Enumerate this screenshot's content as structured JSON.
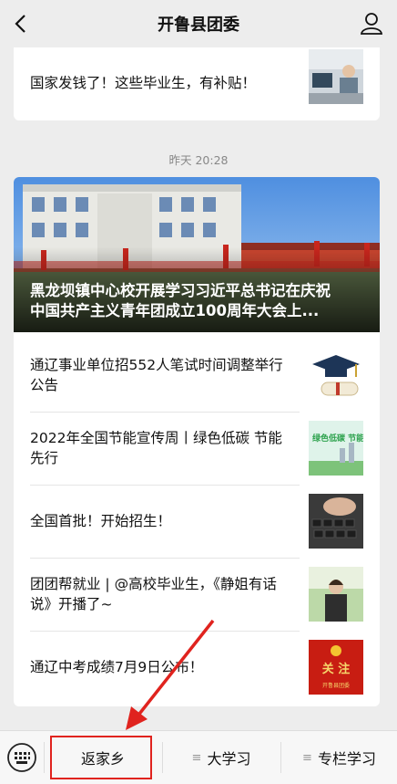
{
  "header": {
    "title": "开鲁县团委"
  },
  "top_article": {
    "title": "国家发钱了！这些毕业生，有补贴！"
  },
  "timestamp": "昨天 20:28",
  "hero": {
    "title_line1": "黑龙坝镇中心校开展学习习近平总书记在庆祝",
    "title_line2": "中国共产主义青年团成立100周年大会上..."
  },
  "articles": [
    {
      "title": "通辽事业单位招552人笔试时间调整举行公告"
    },
    {
      "title": "2022年全国节能宣传周丨绿色低碳 节能先行"
    },
    {
      "title": "全国首批！开始招生！"
    },
    {
      "title": "团团帮就业 | @高校毕业生，《静姐有话说》开播了~"
    },
    {
      "title": "通辽中考成绩7月9日公布！"
    }
  ],
  "thumb_texts": {
    "green_banner": "绿色低碳 节能先行",
    "follow": "关 注",
    "follow_sub": "开鲁县团委"
  },
  "menu": [
    {
      "label": "返家乡"
    },
    {
      "label": "大学习"
    },
    {
      "label": "专栏学习"
    }
  ],
  "colors": {
    "accent_red": "#e0231e"
  }
}
